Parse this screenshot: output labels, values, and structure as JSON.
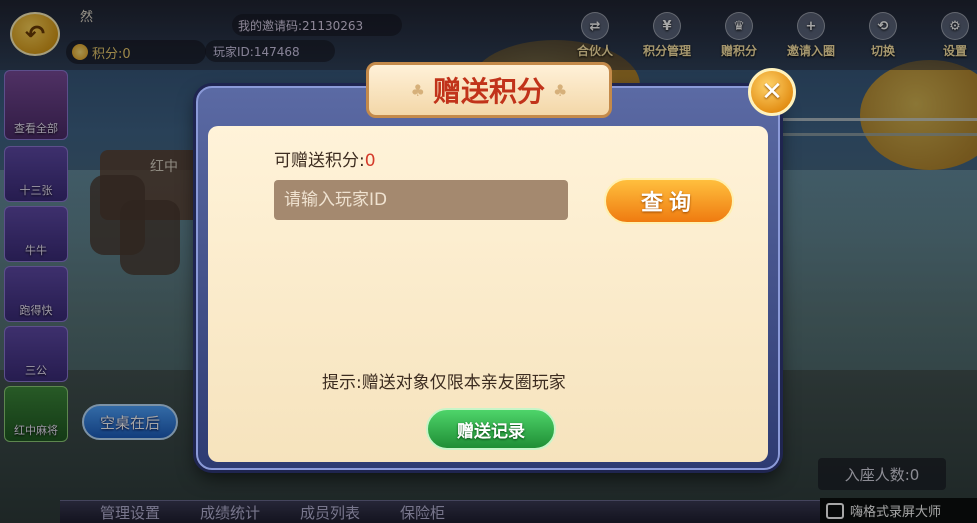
{
  "header": {
    "user_name": "然",
    "points_label": "积分:0",
    "invite_code": "我的邀请码:21130263",
    "player_id": "玩家ID:147468",
    "menu": [
      {
        "label": "合伙人",
        "icon": "handshake-icon",
        "glyph": "⇄"
      },
      {
        "label": "积分管理",
        "icon": "yen-coin-icon",
        "glyph": "¥"
      },
      {
        "label": "赠积分",
        "icon": "trophy-icon",
        "glyph": "♛"
      },
      {
        "label": "邀请入圈",
        "icon": "add-user-icon",
        "glyph": "+"
      },
      {
        "label": "切换",
        "icon": "switch-icon",
        "glyph": "⟲"
      },
      {
        "label": "设置",
        "icon": "gear-icon",
        "glyph": "⚙"
      }
    ]
  },
  "left_rail": {
    "all": "查看全部",
    "games": [
      "十三张",
      "牛牛",
      "跑得快",
      "三公",
      "红中麻将"
    ]
  },
  "table": {
    "label": "红中"
  },
  "empty_table_button": "空桌在后",
  "seated_count": "入座人数:0",
  "bottom_bar": [
    "管理设置",
    "成绩统计",
    "成员列表",
    "保险柜"
  ],
  "watermark": "嗨格式录屏大师",
  "dialog": {
    "title": "赠送积分",
    "available_label": "可赠送积分:",
    "available_value": "0",
    "player_id_placeholder": "请输入玩家ID",
    "query_button": "查询",
    "hint": "提示:赠送对象仅限本亲友圈玩家",
    "record_button": "赠送记录"
  },
  "colors": {
    "title_red": "#c1331a",
    "query_orange": "#ef7b10",
    "record_green": "#1f8e35",
    "value_red": "#d43a2a"
  }
}
